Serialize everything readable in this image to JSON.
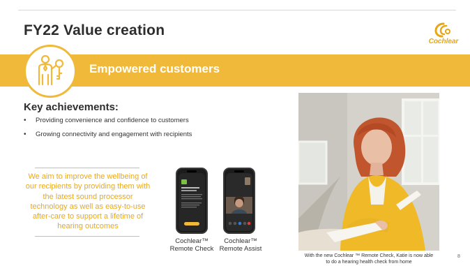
{
  "slide": {
    "title": "FY22 Value creation",
    "page_number": "8"
  },
  "brand": {
    "logo_text": "Cochlear",
    "accent_color": "#f0b93a",
    "quote_color": "#e8a91c"
  },
  "band": {
    "title": "Empowered customers",
    "icon": "person-with-key-icon"
  },
  "achievements": {
    "heading": "Key achievements:",
    "items": [
      "Providing convenience and confidence to customers",
      "Growing connectivity and engagement with recipients"
    ]
  },
  "quote": {
    "text": "We aim to improve the wellbeing of our recipients by providing them with the latest sound processor technology as well as easy-to-use after-care to support a lifetime of hearing outcomes"
  },
  "phones": [
    {
      "label_line1": "Cochlear™",
      "label_line2": "Remote Check"
    },
    {
      "label_line1": "Cochlear™",
      "label_line2": "Remote Assist"
    }
  ],
  "photo": {
    "caption_line1": "With the new Cochlear ™ Remote Check, Katie is now able",
    "caption_line2": "to do a hearing health check from home"
  }
}
